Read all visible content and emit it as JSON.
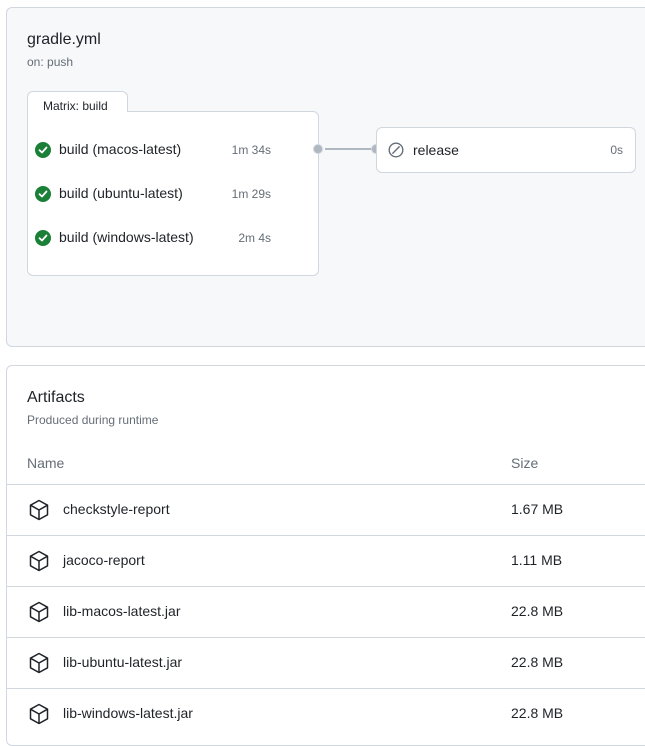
{
  "workflow": {
    "title": "gradle.yml",
    "trigger": "on: push",
    "matrix": {
      "label": "Matrix: build",
      "jobs": [
        {
          "name": "build (macos-latest)",
          "duration": "1m 34s",
          "status": "success"
        },
        {
          "name": "build (ubuntu-latest)",
          "duration": "1m 29s",
          "status": "success"
        },
        {
          "name": "build (windows-latest)",
          "duration": "2m 4s",
          "status": "success"
        }
      ]
    },
    "release": {
      "name": "release",
      "duration": "0s",
      "status": "skipped"
    }
  },
  "artifacts": {
    "title": "Artifacts",
    "subtitle": "Produced during runtime",
    "columns": {
      "name": "Name",
      "size": "Size"
    },
    "items": [
      {
        "name": "checkstyle-report",
        "size": "1.67 MB"
      },
      {
        "name": "jacoco-report",
        "size": "1.11 MB"
      },
      {
        "name": "lib-macos-latest.jar",
        "size": "22.8 MB"
      },
      {
        "name": "lib-ubuntu-latest.jar",
        "size": "22.8 MB"
      },
      {
        "name": "lib-windows-latest.jar",
        "size": "22.8 MB"
      }
    ]
  },
  "colors": {
    "success": "#1a7f37",
    "muted": "#656d76",
    "border": "#d0d7de",
    "canvas": "#f6f8fa"
  },
  "icons": {
    "success": "check-circle-fill-icon",
    "skipped": "skip-icon",
    "artifact": "package-icon"
  }
}
